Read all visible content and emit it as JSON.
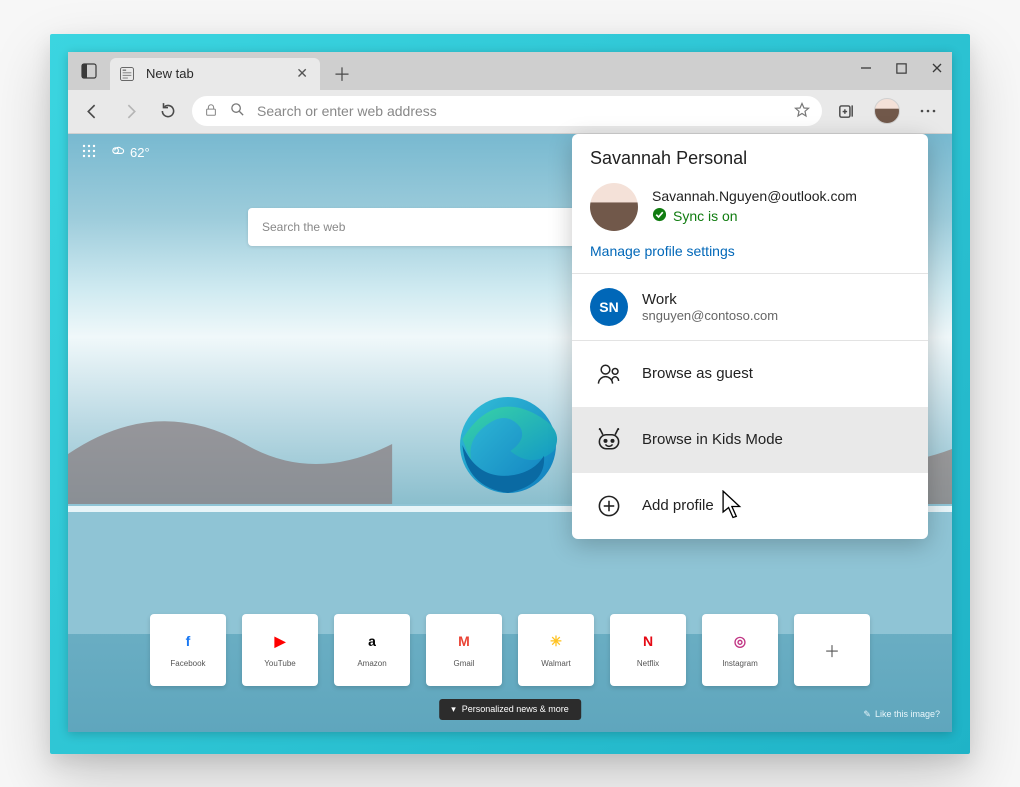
{
  "tab": {
    "title": "New tab"
  },
  "toolbar": {
    "address_placeholder": "Search or enter web address"
  },
  "content": {
    "temperature": "62°",
    "search_placeholder": "Search the web",
    "news_label": "Personalized news & more",
    "like_label": "Like this image?"
  },
  "tiles": [
    {
      "label": "Facebook",
      "color": "#1877F2",
      "glyph": "f"
    },
    {
      "label": "YouTube",
      "color": "#FF0000",
      "glyph": "▶"
    },
    {
      "label": "Amazon",
      "color": "#000000",
      "glyph": "a"
    },
    {
      "label": "Gmail",
      "color": "#EA4335",
      "glyph": "M"
    },
    {
      "label": "Walmart",
      "color": "#FFC220",
      "glyph": "✳"
    },
    {
      "label": "Netflix",
      "color": "#E50914",
      "glyph": "N"
    },
    {
      "label": "Instagram",
      "color": "#C13584",
      "glyph": "◎"
    }
  ],
  "profile": {
    "title": "Savannah Personal",
    "email": "Savannah.Nguyen@outlook.com",
    "sync_label": "Sync is on",
    "manage_label": "Manage profile settings",
    "work": {
      "initials": "SN",
      "name": "Work",
      "email": "snguyen@contoso.com"
    },
    "guest_label": "Browse as guest",
    "kids_label": "Browse in Kids Mode",
    "add_label": "Add profile"
  }
}
